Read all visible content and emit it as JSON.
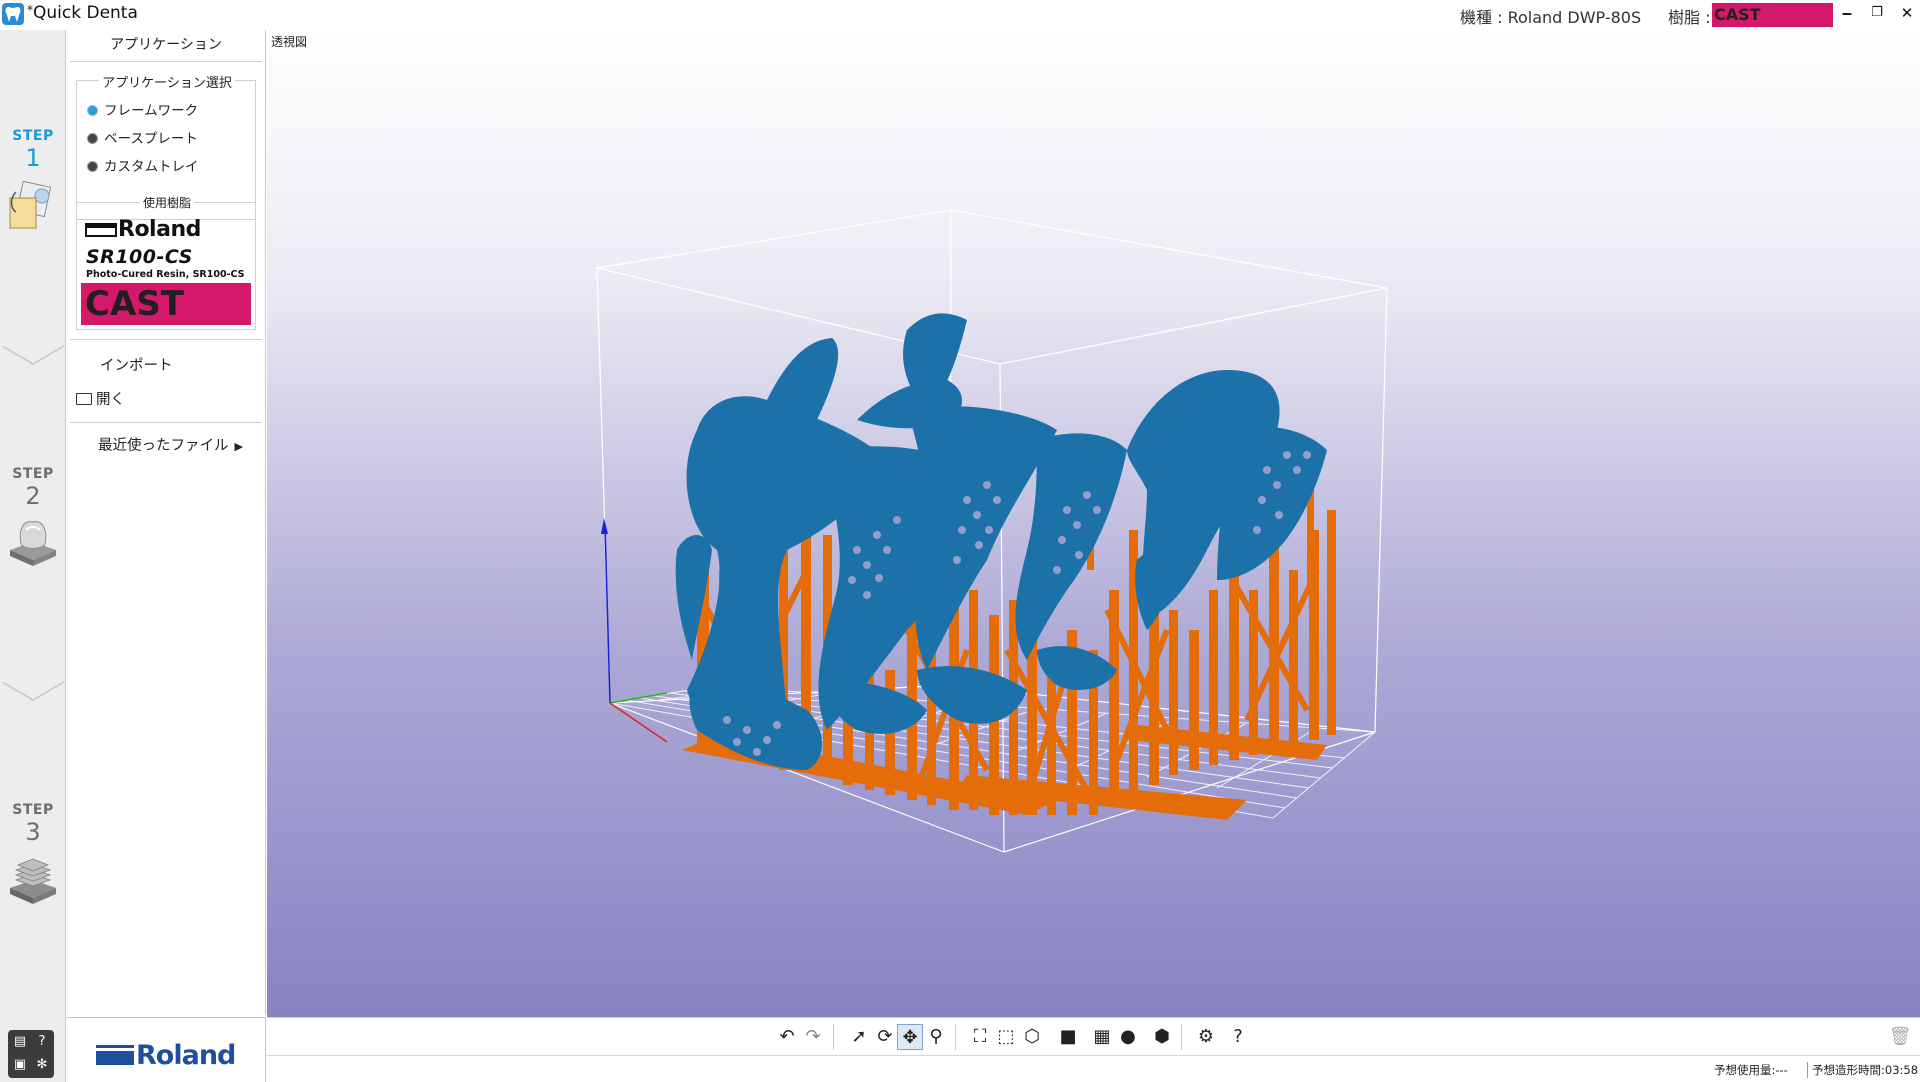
{
  "window": {
    "title": "Quick Denta",
    "title_prefix": "*",
    "model_info": "機種 : Roland DWP-80S",
    "resin_label": "樹脂 :",
    "resin_value": "CAST",
    "resin_color": "#d4186a"
  },
  "steps": [
    {
      "label": "STEP",
      "number": "1",
      "active": true,
      "icon": "framework-document-icon"
    },
    {
      "label": "STEP",
      "number": "2",
      "active": false,
      "icon": "tooth-on-platform-icon"
    },
    {
      "label": "STEP",
      "number": "3",
      "active": false,
      "icon": "sliced-layers-icon"
    }
  ],
  "panel": {
    "title": "アプリケーション",
    "app_select_title": "アプリケーション選択",
    "app_options": [
      {
        "label": "フレームワーク",
        "checked": true
      },
      {
        "label": "ベースプレート",
        "checked": false
      },
      {
        "label": "カスタムトレイ",
        "checked": false
      }
    ],
    "resin_group_title": "使用樹脂",
    "resin_brand": "Roland",
    "resin_name": "SR100-CS",
    "resin_desc": "Photo-Cured Resin, SR100-CS",
    "resin_type": "CAST",
    "import_label": "インポート",
    "open_label": "開く",
    "recent_label": "最近使ったファイル"
  },
  "brand": {
    "logo_text": "Roland",
    "color": "#1f4f9c"
  },
  "viewport": {
    "view_name": "透視図",
    "colors": {
      "model": "#1c72a8",
      "support": "#e46d0a",
      "box": "#ffffff"
    }
  },
  "toolbar": {
    "icons": [
      "undo-icon",
      "redo-icon",
      "select-icon",
      "rotate-icon",
      "pan-icon",
      "zoom-icon",
      "fit-view-icon",
      "fit-selection-icon",
      "view-direction-icon",
      "display-mode-icon",
      "grid-icon",
      "material-icon",
      "platform-icon",
      "settings-icon",
      "help-icon",
      "trash-icon"
    ],
    "active": "pan-icon"
  },
  "status": {
    "est_usage": "予想使用量:---",
    "est_time": "予想造形時間:03:58"
  }
}
